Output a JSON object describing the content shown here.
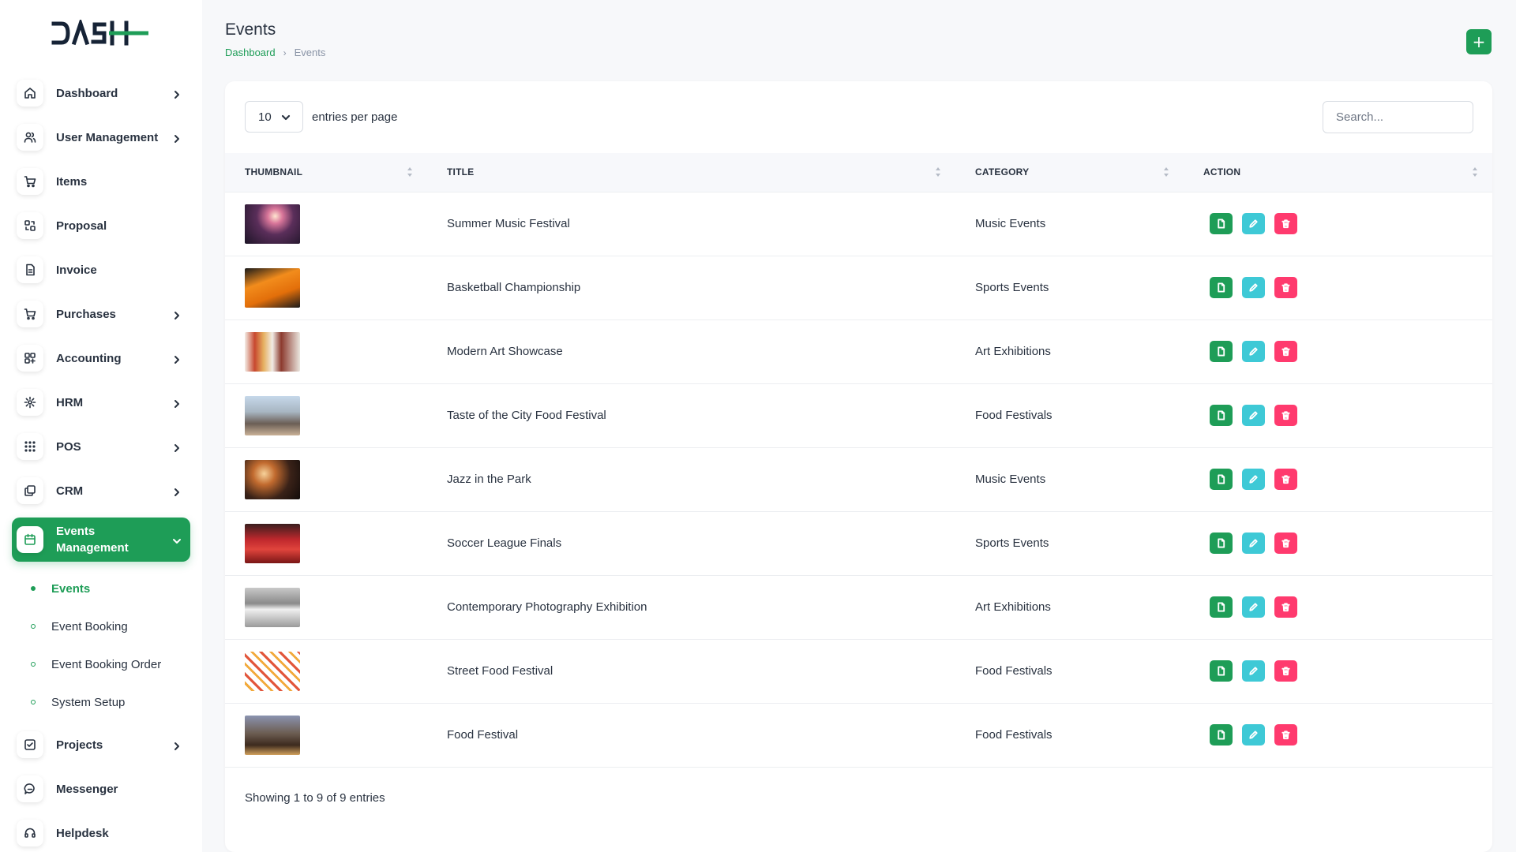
{
  "brand": {
    "logo_text": "DASH",
    "accent": "#1e9d57"
  },
  "sidebar": {
    "items": [
      {
        "label": "Dashboard",
        "icon": "home-icon",
        "has_children": true
      },
      {
        "label": "User Management",
        "icon": "users-icon",
        "has_children": true
      },
      {
        "label": "Items",
        "icon": "cart-icon",
        "has_children": false
      },
      {
        "label": "Proposal",
        "icon": "proposal-icon",
        "has_children": false
      },
      {
        "label": "Invoice",
        "icon": "file-invoice-icon",
        "has_children": false
      },
      {
        "label": "Purchases",
        "icon": "cart-icon",
        "has_children": true
      },
      {
        "label": "Accounting",
        "icon": "grid-icon",
        "has_children": true
      },
      {
        "label": "HRM",
        "icon": "hrm-icon",
        "has_children": true
      },
      {
        "label": "POS",
        "icon": "dots-grid-icon",
        "has_children": true
      },
      {
        "label": "CRM",
        "icon": "layers-icon",
        "has_children": true
      },
      {
        "label": "Events Management",
        "icon": "calendar-icon",
        "has_children": true,
        "active": true
      },
      {
        "label": "Projects",
        "icon": "checkbox-icon",
        "has_children": true
      },
      {
        "label": "Messenger",
        "icon": "message-icon",
        "has_children": false
      },
      {
        "label": "Helpdesk",
        "icon": "headset-icon",
        "has_children": false
      }
    ],
    "submenu": [
      {
        "label": "Events",
        "active": true
      },
      {
        "label": "Event Booking"
      },
      {
        "label": "Event Booking Order"
      },
      {
        "label": "System Setup"
      }
    ]
  },
  "header": {
    "title": "Events",
    "breadcrumb": {
      "home": "Dashboard",
      "separator": "›",
      "current": "Events"
    },
    "add_button": "+"
  },
  "table_controls": {
    "entries_value": "10",
    "entries_label": "entries per page",
    "search_placeholder": "Search..."
  },
  "table": {
    "columns": [
      "THUMBNAIL",
      "TITLE",
      "CATEGORY",
      "ACTION"
    ],
    "rows": [
      {
        "title": "Summer Music Festival",
        "category": "Music Events",
        "thumb": "concert"
      },
      {
        "title": "Basketball Championship",
        "category": "Sports Events",
        "thumb": "sports"
      },
      {
        "title": "Modern Art Showcase",
        "category": "Art Exhibitions",
        "thumb": "gallery"
      },
      {
        "title": "Taste of the City Food Festival",
        "category": "Food Festivals",
        "thumb": "crowd"
      },
      {
        "title": "Jazz in the Park",
        "category": "Music Events",
        "thumb": "night"
      },
      {
        "title": "Soccer League Finals",
        "category": "Sports Events",
        "thumb": "team"
      },
      {
        "title": "Contemporary Photography Exhibition",
        "category": "Art Exhibitions",
        "thumb": "hall"
      },
      {
        "title": "Street Food Festival",
        "category": "Food Festivals",
        "thumb": "food"
      },
      {
        "title": "Food Festival",
        "category": "Food Festivals",
        "thumb": "dusk"
      }
    ],
    "action_colors": {
      "view": "#1e9d57",
      "edit": "#3ec9d6",
      "delete": "#ff3a6e"
    }
  },
  "footer": {
    "info": "Showing 1 to 9 of 9 entries"
  }
}
